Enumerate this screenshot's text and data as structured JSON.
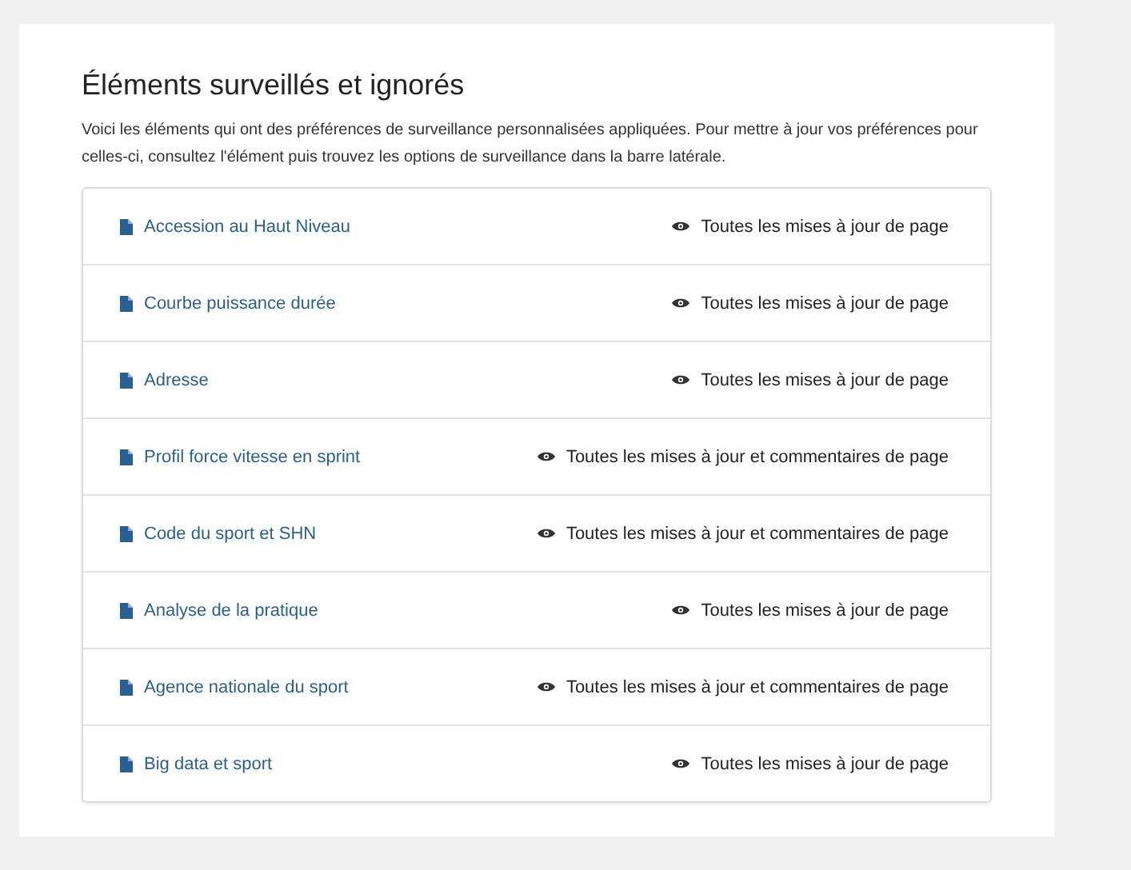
{
  "title": "Éléments surveillés et ignorés",
  "description": "Voici les éléments qui ont des préférences de surveillance personnalisées appliquées. Pour mettre à jour vos préférences pour celles-ci, consultez l'élément puis trouvez les options de surveillance dans la barre latérale.",
  "items": [
    {
      "name": "Accession au Haut Niveau",
      "watch": "Toutes les mises à jour de page"
    },
    {
      "name": "Courbe puissance durée",
      "watch": "Toutes les mises à jour de page"
    },
    {
      "name": "Adresse",
      "watch": "Toutes les mises à jour de page"
    },
    {
      "name": "Profil force vitesse en sprint",
      "watch": "Toutes les mises à jour et commentaires de page"
    },
    {
      "name": "Code du sport et SHN",
      "watch": "Toutes les mises à jour et commentaires de page"
    },
    {
      "name": "Analyse de la pratique",
      "watch": "Toutes les mises à jour de page"
    },
    {
      "name": "Agence nationale du sport",
      "watch": "Toutes les mises à jour et commentaires de page"
    },
    {
      "name": "Big data et sport",
      "watch": "Toutes les mises à jour de page"
    }
  ]
}
